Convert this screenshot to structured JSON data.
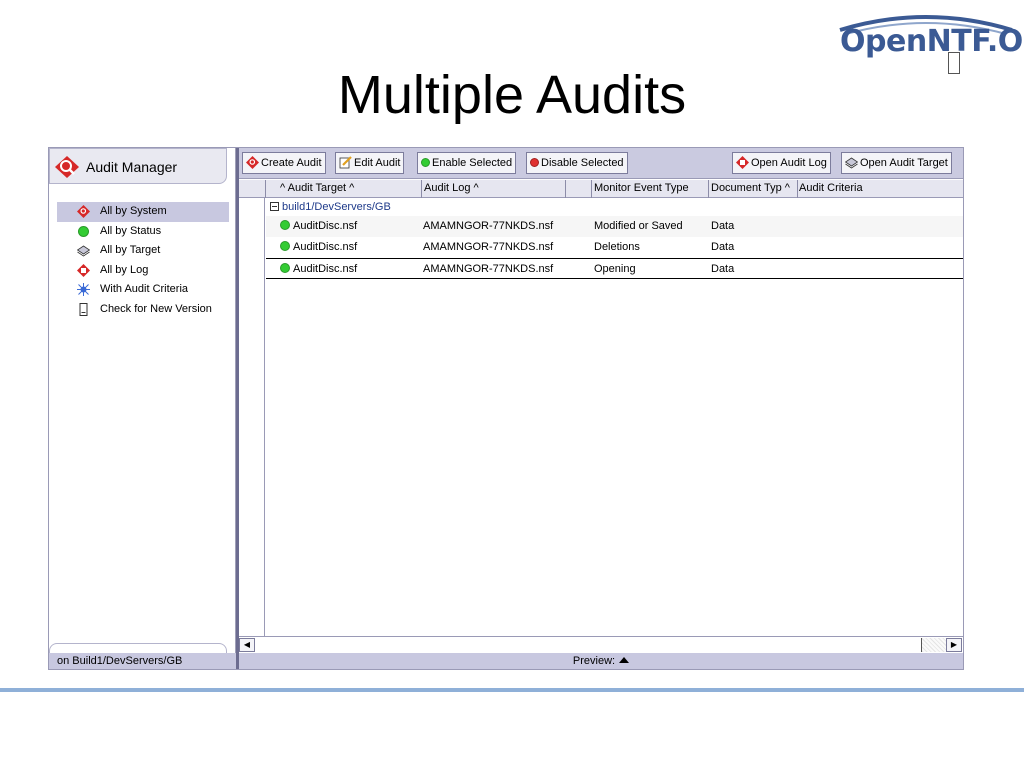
{
  "logo": {
    "text": "OpenNTF.Org"
  },
  "slide": {
    "title": "Multiple Audits"
  },
  "app": {
    "name": "Audit Manager",
    "nav": [
      {
        "label": "All by System",
        "icon": "audit-icon",
        "selected": true
      },
      {
        "label": "All by Status",
        "icon": "green-status-icon",
        "selected": false
      },
      {
        "label": "All by Target",
        "icon": "database-icon",
        "selected": false
      },
      {
        "label": "All by Log",
        "icon": "log-icon",
        "selected": false
      },
      {
        "label": "With Audit Criteria",
        "icon": "bug-icon",
        "selected": false
      },
      {
        "label": "Check for New Version",
        "icon": "document-icon",
        "selected": false
      }
    ],
    "status_left": "on Build1/DevServers/GB",
    "toolbar": {
      "create": "Create Audit",
      "edit": "Edit Audit",
      "enable": "Enable Selected",
      "disable": "Disable Selected",
      "open_log": "Open Audit Log",
      "open_target": "Open Audit Target"
    },
    "columns": [
      "^ Audit Target ^",
      "Audit Log ^",
      "Monitor Event Type",
      "Document Typ ^",
      "Audit Criteria"
    ],
    "category": "build1/DevServers/GB",
    "rows": [
      {
        "target": "AuditDisc.nsf",
        "log": "AMAMNGOR-77NKDS.nsf",
        "event": "Modified or Saved",
        "doctype": "Data",
        "criteria": ""
      },
      {
        "target": "AuditDisc.nsf",
        "log": "AMAMNGOR-77NKDS.nsf",
        "event": "Deletions",
        "doctype": "Data",
        "criteria": ""
      },
      {
        "target": "AuditDisc.nsf",
        "log": "AMAMNGOR-77NKDS.nsf",
        "event": "Opening",
        "doctype": "Data",
        "criteria": ""
      }
    ],
    "preview_label": "Preview:",
    "colors": {
      "accent": "#c8c8e0",
      "status_enabled": "#33cc33",
      "status_disabled": "#e03030",
      "brand": "#3b5a94"
    }
  }
}
